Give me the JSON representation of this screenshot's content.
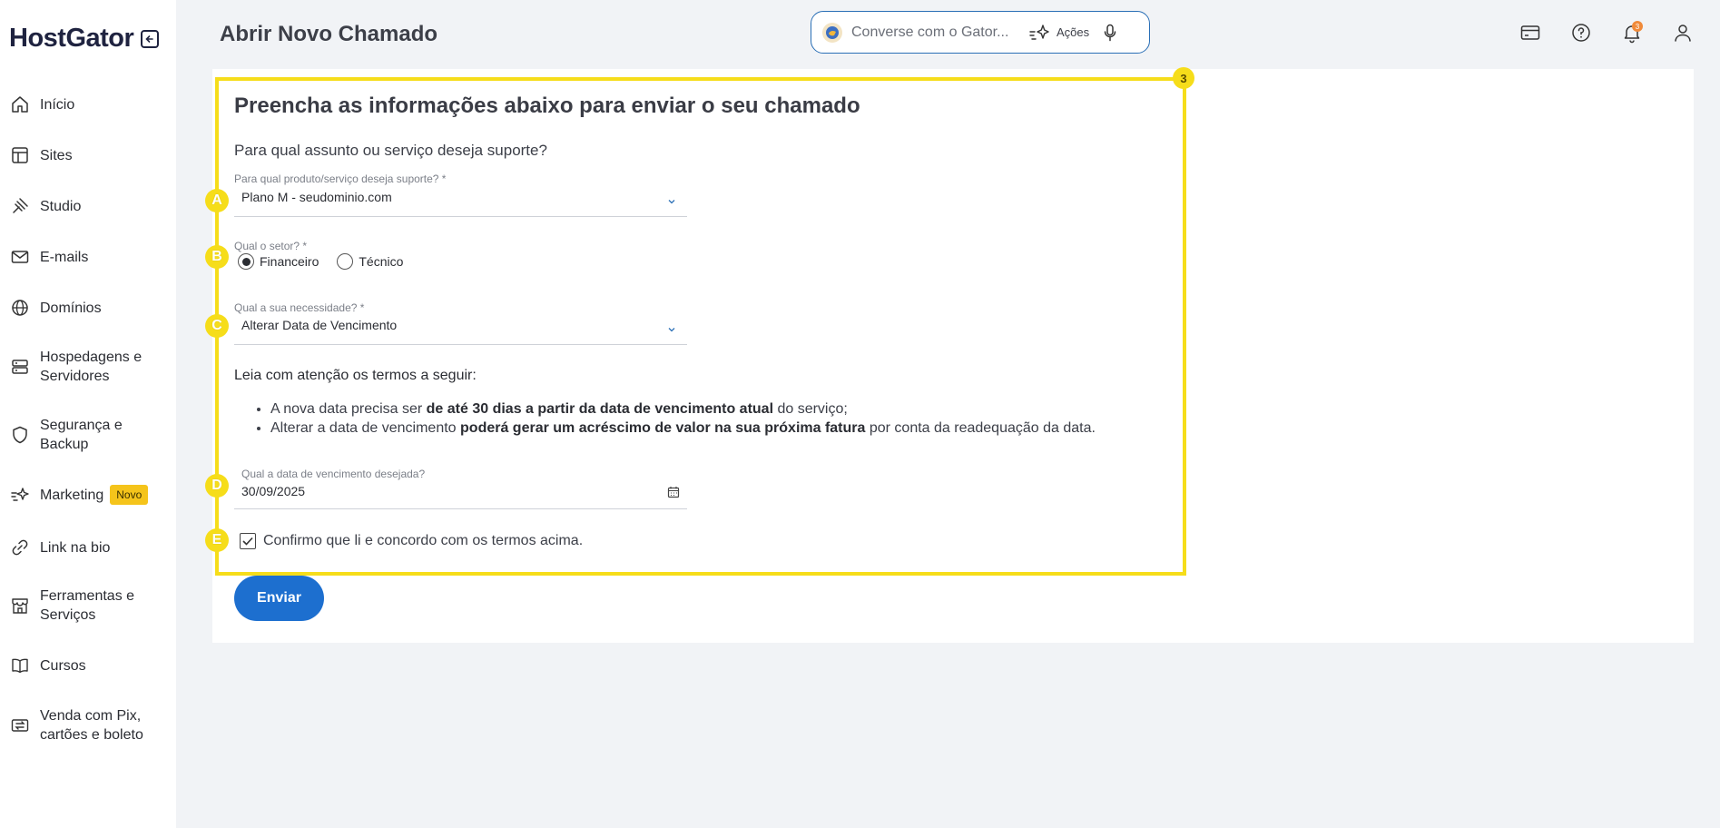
{
  "sidebar": {
    "logo": "HostGator",
    "items": [
      {
        "label": "Início",
        "icon": "home-icon"
      },
      {
        "label": "Sites",
        "icon": "layout-icon"
      },
      {
        "label": "Studio",
        "icon": "studio-icon"
      },
      {
        "label": "E-mails",
        "icon": "mail-icon"
      },
      {
        "label": "Domínios",
        "icon": "globe-icon"
      },
      {
        "label": "Hospedagens e Servidores",
        "icon": "server-icon"
      },
      {
        "label": "Segurança e Backup",
        "icon": "shield-icon"
      },
      {
        "label": "Marketing",
        "icon": "sparkle-icon",
        "badge": "Novo"
      },
      {
        "label": "Link na bio",
        "icon": "link-icon"
      },
      {
        "label": "Ferramentas e Serviços",
        "icon": "store-icon"
      },
      {
        "label": "Cursos",
        "icon": "book-icon"
      },
      {
        "label": "Venda com Pix, cartões e boleto",
        "icon": "payment-icon"
      }
    ]
  },
  "header": {
    "title": "Abrir Novo Chamado",
    "gator_placeholder": "Converse com o Gator...",
    "actions_label": "Ações",
    "notifications_count": "3"
  },
  "highlight_markers": {
    "section": "3",
    "a": "A",
    "b": "B",
    "c": "C",
    "d": "D",
    "e": "E"
  },
  "form": {
    "title": "Preencha as informações abaixo para enviar o seu chamado",
    "question": "Para qual assunto ou serviço deseja suporte?",
    "product_label": "Para qual produto/serviço deseja suporte? *",
    "product_value": "Plano M - seudominio.com",
    "sector_label": "Qual o setor? *",
    "sector_options": [
      "Financeiro",
      "Técnico"
    ],
    "sector_selected": "Financeiro",
    "need_label": "Qual a sua necessidade? *",
    "need_value": "Alterar Data de Vencimento",
    "terms_title": "Leia com atenção os termos a seguir:",
    "term1_pre": "A nova data precisa ser ",
    "term1_bold": "de até 30 dias a partir da data de vencimento atual",
    "term1_post": " do serviço;",
    "term2_pre": "Alterar a data de vencimento ",
    "term2_bold": "poderá gerar um acréscimo de valor na sua próxima fatura",
    "term2_post": " por conta da readequação da data.",
    "date_label": "Qual a data de vencimento desejada?",
    "date_value": "30/09/2025",
    "confirm_label": "Confirmo que li e concordo com os termos acima.",
    "confirm_checked": true,
    "submit_label": "Enviar"
  },
  "colors": {
    "accent": "#1d6fcf",
    "highlight": "#f6dd1a",
    "badge": "#f5c41b"
  }
}
